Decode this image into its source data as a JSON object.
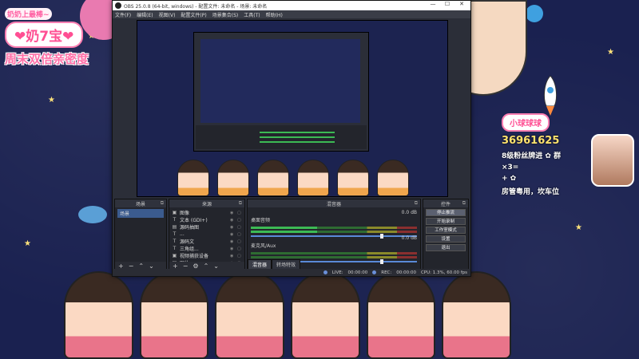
{
  "overlay": {
    "top_tag": "奶奶上最棒~",
    "name": "❤奶7宝❤",
    "slogan": "周末双倍亲密度"
  },
  "fan_panel": {
    "title": "小球球球",
    "number": "36961625",
    "rank": "8级粉丝牌进 ✿ 群",
    "multiplier": "×3=",
    "extra": "+ ✿",
    "line": "房管粤用，坎车位"
  },
  "obs": {
    "title": "OBS 25.0.8 (64-bit, windows) - 配置文件: 未命名 - 场景: 未命名",
    "window_controls": [
      "—",
      "☐",
      "✕"
    ],
    "menu": [
      "文件(F)",
      "编辑(E)",
      "视图(V)",
      "配置文件(P)",
      "场景集合(S)",
      "工具(T)",
      "帮助(H)"
    ],
    "docks": {
      "scenes": {
        "title": "场景",
        "items": [
          "场景"
        ]
      },
      "sources": {
        "title": "来源",
        "items": [
          {
            "icon": "▣",
            "name": "图像"
          },
          {
            "icon": "T",
            "name": "文本 (GDI+)"
          },
          {
            "icon": "▤",
            "name": "源码抽图"
          },
          {
            "icon": "T",
            "name": "..."
          },
          {
            "icon": "T",
            "name": "源码文"
          },
          {
            "icon": "T",
            "name": "三角组..."
          },
          {
            "icon": "▣",
            "name": "视频捕获设备"
          },
          {
            "icon": "▣",
            "name": "图片"
          }
        ]
      },
      "mixer": {
        "title": "混音器",
        "channels": [
          {
            "name": "桌面音频",
            "db": "0.0 dB"
          },
          {
            "name": "麦克风/Aux",
            "db": "0.0 dB"
          }
        ],
        "tabs": [
          "混音器",
          "转场特效"
        ]
      },
      "controls": {
        "title": "控件",
        "buttons": [
          "停止推流",
          "开始录制",
          "工作室模式",
          "设置",
          "退出"
        ]
      }
    },
    "status": {
      "live_label": "LIVE:",
      "live_time": "00:00:00",
      "rec_label": "REC:",
      "rec_time": "00:00:00",
      "cpu": "CPU: 1.3%, 60.00 fps"
    }
  }
}
